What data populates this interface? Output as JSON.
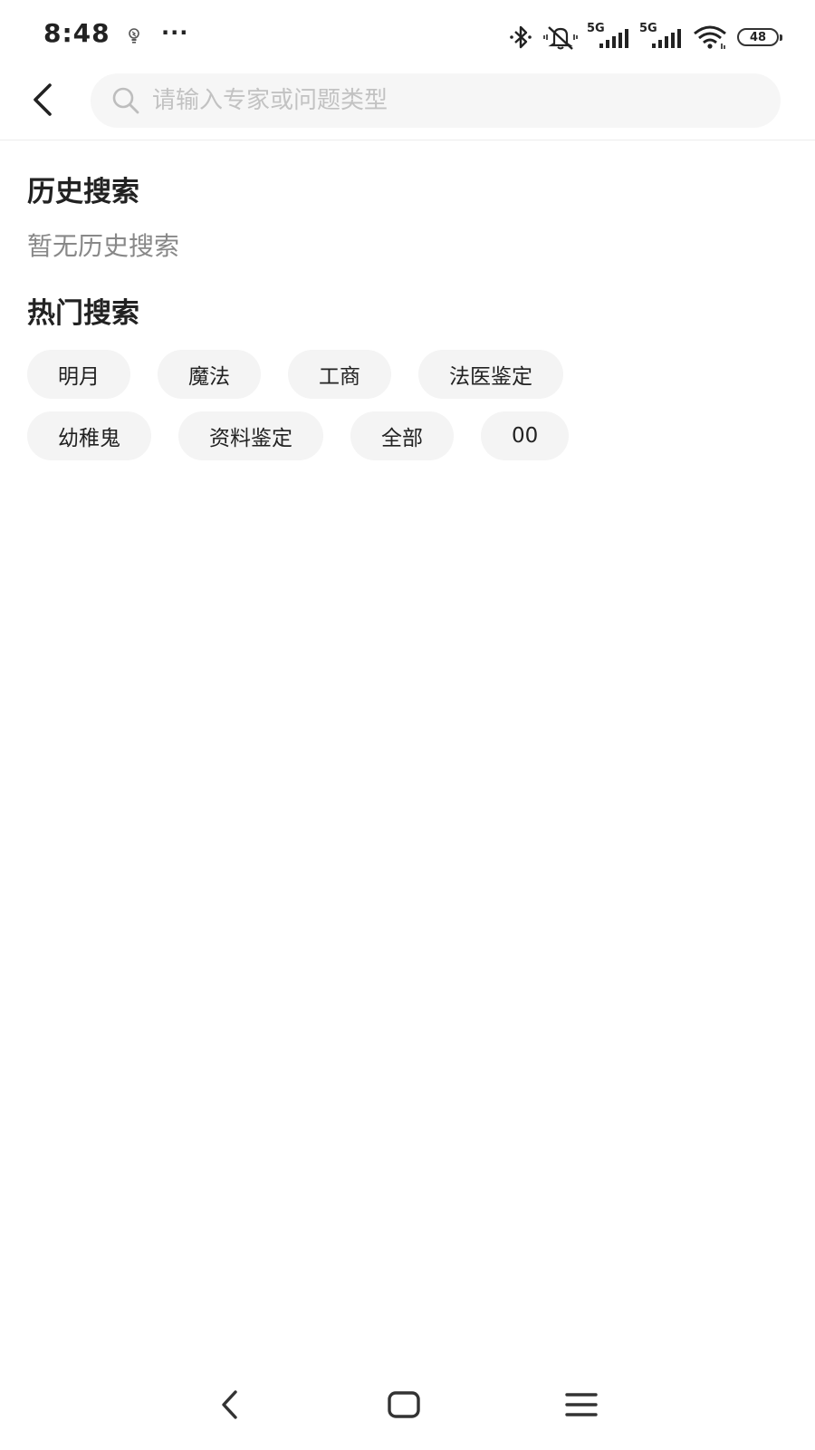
{
  "status_bar": {
    "time": "8:48",
    "dots": "···",
    "net1": "5G",
    "net2": "5G",
    "battery": "48",
    "icons": [
      "lightbulb-icon",
      "bluetooth-icon",
      "mute-icon",
      "signal-icon",
      "signal-icon",
      "wifi-icon",
      "battery-icon"
    ]
  },
  "search": {
    "placeholder": "请输入专家或问题类型",
    "value": ""
  },
  "history": {
    "title": "历史搜索",
    "empty_text": "暂无历史搜索"
  },
  "hot": {
    "title": "热门搜索",
    "tags": [
      "明月",
      "魔法",
      "工商",
      "法医鉴定",
      "幼稚鬼",
      "资料鉴定",
      "全部",
      "00"
    ]
  },
  "nav": {
    "icons": [
      "back-icon",
      "home-icon",
      "menu-icon"
    ]
  },
  "colors": {
    "tag_bg": "#f4f4f4",
    "search_bg": "#f6f6f6",
    "placeholder": "#c2c2c2",
    "muted_text": "#888888"
  }
}
